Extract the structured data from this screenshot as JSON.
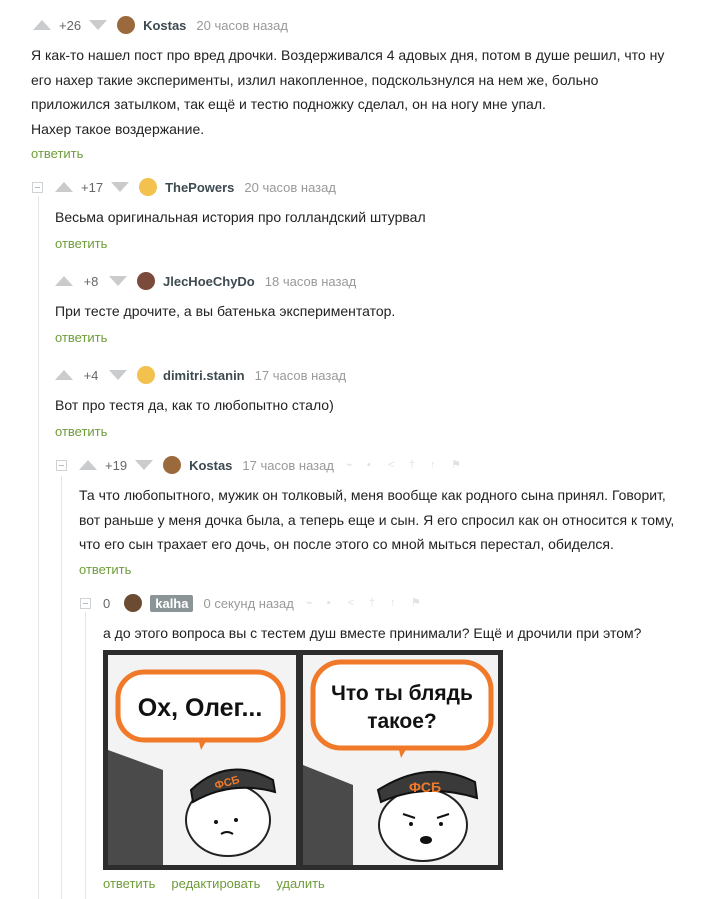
{
  "reply_label": "ответить",
  "comments": [
    {
      "rating": "+26",
      "user": "Kostas",
      "time": "20 часов назад",
      "lines": [
        "Я как-то нашел пост про вред дрочки. Воздерживался 4 адовых дня, потом в душе решил, что ну",
        "его нахер такие эксперименты, излил накопленное, подскользнулся на нем же, больно",
        "приложился затылком, так ещё и тестю подножку сделал, он на ногу мне упал.",
        "Нахер такое воздержание."
      ]
    },
    {
      "rating": "+17",
      "user": "ThePowers",
      "time": "20 часов назад",
      "lines": [
        "Весьма оригинальная история про голландский штурвал"
      ]
    },
    {
      "rating": "+8",
      "user": "JlecHoeChyDo",
      "time": "18 часов назад",
      "lines": [
        "При тесте дрочите, а вы батенька экспериментатор."
      ]
    },
    {
      "rating": "+4",
      "user": "dimitri.stanin",
      "time": "17 часов назад",
      "lines": [
        "Вот про тестя да, как то любопытно стало)"
      ]
    },
    {
      "rating": "+19",
      "user": "Kostas",
      "time": "17 часов назад",
      "lines": [
        "Та что любопытного, мужик он толковый, меня вообще как родного сына принял. Говорит,",
        "вот раньше у меня дочка была, а теперь еще и сын. Я его спросил как он относится к тому,",
        "что его сын трахает его дочь, он после этого со мной мыться перестал, обиделся."
      ]
    },
    {
      "rating": "0",
      "user": "kalha",
      "time": "0 секунд назад",
      "lines": [
        "а до этого вопроса вы с тестем душ вместе принимали? Ещё и дрочили при этом?"
      ],
      "actions": [
        "ответить",
        "редактировать",
        "удалить"
      ]
    }
  ],
  "meme": {
    "left_bubble": "Ох, Олег...",
    "right_bubble_line1": "Что ты блядь",
    "right_bubble_line2": "такое?",
    "cap_text": "ФСБ",
    "bubble_color": "#f07a2a"
  }
}
